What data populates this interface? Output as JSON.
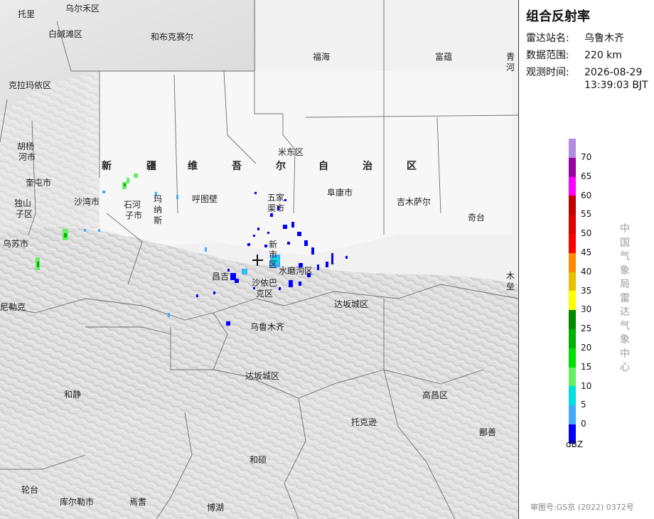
{
  "panel": {
    "title": "组合反射率",
    "station_label": "雷达站名:",
    "station_value": "乌鲁木齐",
    "range_label": "数据范围:",
    "range_value": "220 km",
    "time_label": "观测时间:",
    "time_date": "2026-08-29",
    "time_clock": "13:39:03 BJT",
    "unit": "dBZ",
    "org": "中国气象局雷达气象中心",
    "footer": "审图号:GS京 (2022) 0372号"
  },
  "legend": {
    "ticks": [
      "70",
      "65",
      "60",
      "55",
      "50",
      "45",
      "40",
      "35",
      "30",
      "25",
      "20",
      "15",
      "10",
      "5",
      "0"
    ],
    "colors": [
      "#b08de0",
      "#9900a0",
      "#ff00ff",
      "#c00000",
      "#e00000",
      "#ff0000",
      "#ff8c00",
      "#e8c000",
      "#ffff00",
      "#008800",
      "#00b000",
      "#00e000",
      "#66ee66",
      "#00e0e0",
      "#44aaff",
      "#0000ff"
    ]
  },
  "map": {
    "region_chars": [
      "新",
      "疆",
      "维",
      "吾",
      "尔",
      "自",
      "治",
      "区"
    ],
    "labels": {
      "tuoli": "托里",
      "wuerhe": "乌尔禾区",
      "baijiantan": "白碱滩区",
      "hebukesaier": "和布克赛尔",
      "fuhai": "福海",
      "fuyun": "富蕴",
      "qinghe1": "青",
      "qinghe2": "河",
      "kelamayi": "克拉玛依区",
      "huyang1": "胡杨",
      "huyang2": "河市",
      "kuitun": "奎屯市",
      "dushanzi1": "独山",
      "dushanzi2": "子区",
      "wusu": "乌苏市",
      "shawan": "沙湾市",
      "shihezi1": "石河",
      "shihezi2": "子市",
      "manas1": "玛",
      "manas2": "纳",
      "manas3": "斯",
      "hutubi": "呼图壁",
      "midong": "米东区",
      "wujiaqu1": "五家",
      "wujiaqu2": "渠市",
      "fukang": "阜康市",
      "jimusaer": "吉木萨尔",
      "qitai": "奇台",
      "xinshi1": "新",
      "xinshi2": "市",
      "xinshi3": "区",
      "changji": "昌吉",
      "shuimogou": "水磨沟区",
      "shayibake1": "沙依巴",
      "shayibake2": "克区",
      "dabancheng1": "达坂城区",
      "mulei1": "木",
      "mulei2": "垒",
      "nileke": "尼勒克",
      "wulumuqi": "乌鲁木齐",
      "dabancheng2": "达坂城区",
      "hejing": "和静",
      "gaochang": "高昌区",
      "tuokexun": "托克逊",
      "shanshan": "鄯善",
      "heshuo": "和硕",
      "luntai": "轮台",
      "kuerle": "库尔勒市",
      "yanqi": "焉耆",
      "bohu": "博湖"
    }
  }
}
